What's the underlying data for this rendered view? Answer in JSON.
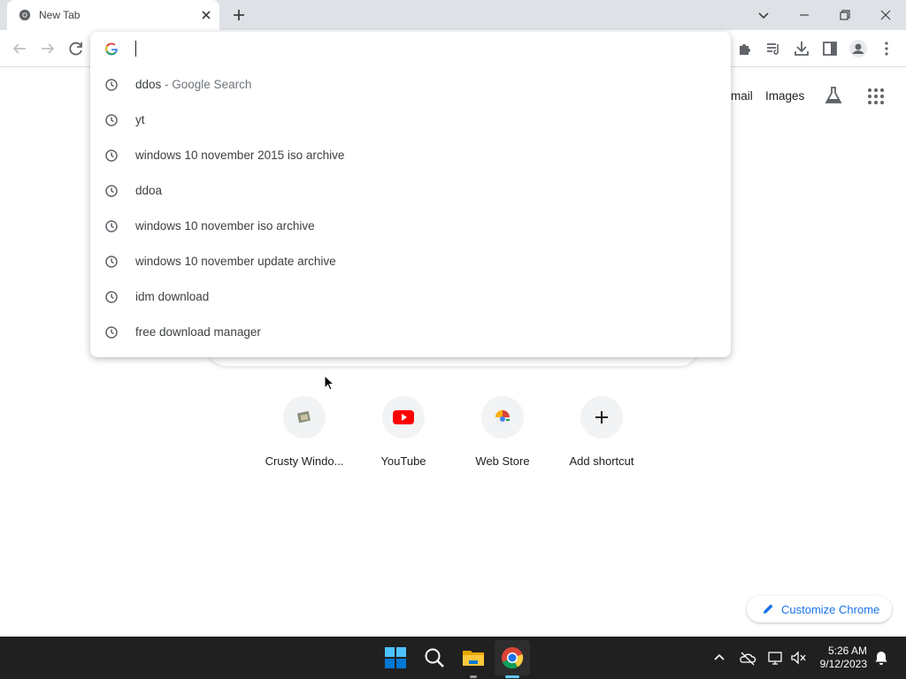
{
  "browser": {
    "tab": {
      "title": "New Tab",
      "favicon": "chrome-icon"
    },
    "window_controls": [
      "tab-search-icon",
      "minimize-icon",
      "restore-icon",
      "close-icon"
    ]
  },
  "omnibox": {
    "value": "",
    "suggestions": [
      {
        "text": "ddos",
        "suffix": " - Google Search",
        "icon": "history-clock-icon"
      },
      {
        "text": "yt",
        "suffix": "",
        "icon": "history-clock-icon"
      },
      {
        "text": "windows 10 november 2015 iso archive",
        "suffix": "",
        "icon": "history-clock-icon"
      },
      {
        "text": "ddoa",
        "suffix": "",
        "icon": "history-clock-icon"
      },
      {
        "text": "windows 10 november iso archive",
        "suffix": "",
        "icon": "history-clock-icon"
      },
      {
        "text": "windows 10 november update archive",
        "suffix": "",
        "icon": "history-clock-icon"
      },
      {
        "text": "idm download",
        "suffix": "",
        "icon": "history-clock-icon"
      },
      {
        "text": "free download manager",
        "suffix": "",
        "icon": "history-clock-icon"
      }
    ]
  },
  "ntp": {
    "header_links": {
      "gmail": "mail",
      "images": "Images"
    },
    "shortcuts": [
      {
        "label": "Crusty Windo...",
        "icon": "crusty-windows-icon"
      },
      {
        "label": "YouTube",
        "icon": "youtube-icon"
      },
      {
        "label": "Web Store",
        "icon": "web-store-icon"
      },
      {
        "label": "Add shortcut",
        "icon": "plus-icon"
      }
    ],
    "customize_label": "Customize Chrome"
  },
  "taskbar": {
    "time": "5:26 AM",
    "date": "9/12/2023"
  },
  "colors": {
    "accent": "#1a73e8",
    "tabstrip": "#dee1e6",
    "taskbar": "#202020"
  }
}
